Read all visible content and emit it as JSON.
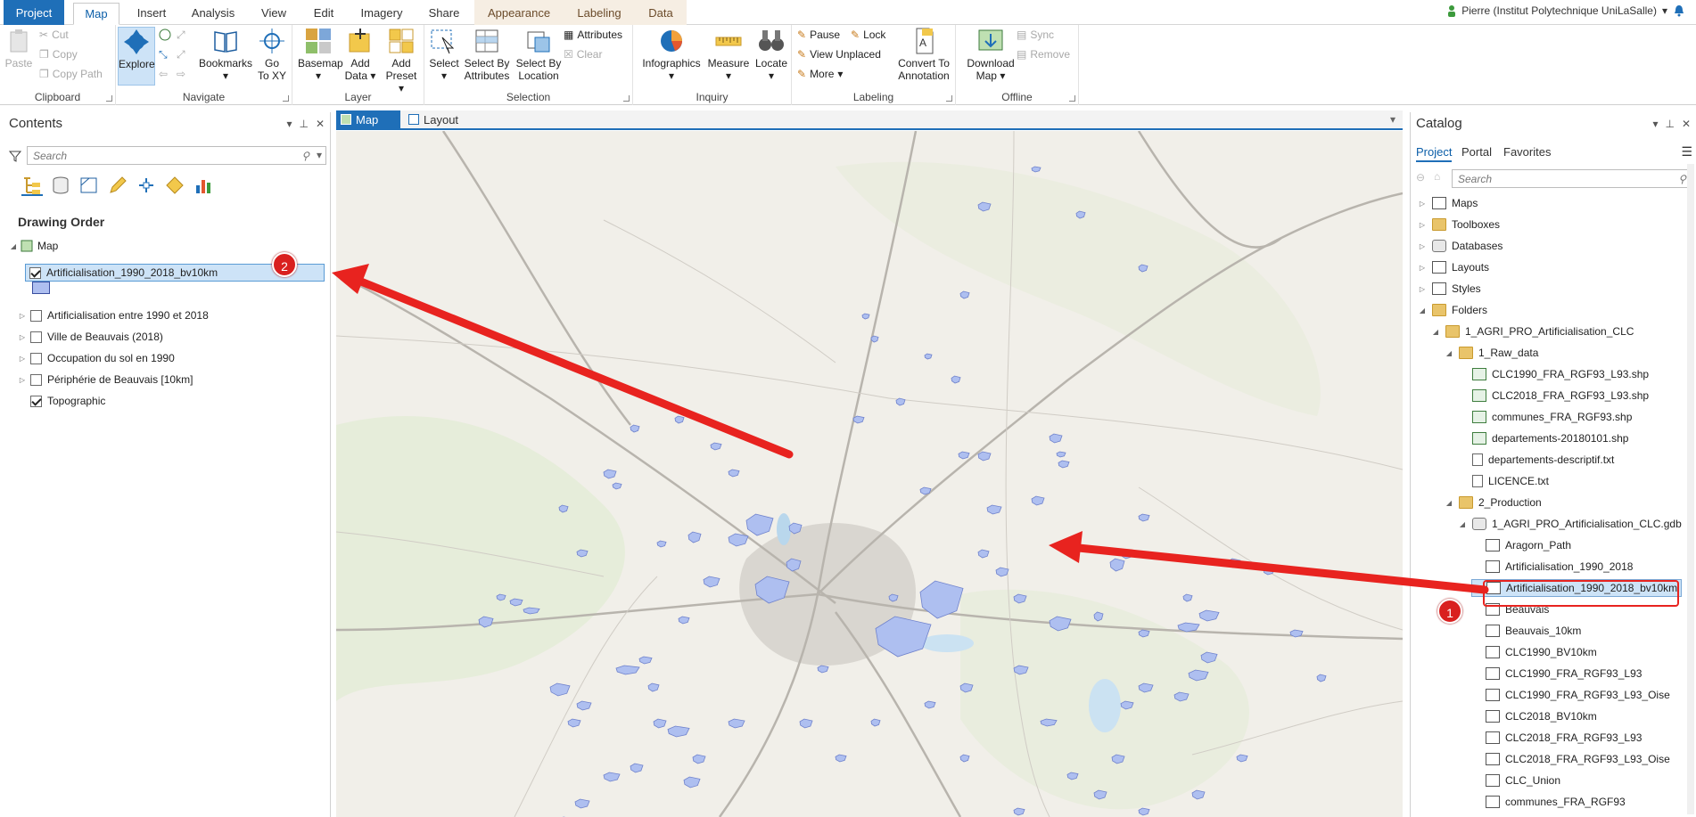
{
  "tabs": {
    "project": "Project",
    "map": "Map",
    "insert": "Insert",
    "analysis": "Analysis",
    "view": "View",
    "edit": "Edit",
    "imagery": "Imagery",
    "share": "Share",
    "appearance": "Appearance",
    "labeling": "Labeling",
    "data": "Data"
  },
  "user": {
    "name": "Pierre (Institut Polytechnique UniLaSalle)"
  },
  "ribbon": {
    "clipboard": {
      "label": "Clipboard",
      "paste": "Paste",
      "cut": "Cut",
      "copy": "Copy",
      "copy_path": "Copy Path"
    },
    "navigate": {
      "label": "Navigate",
      "explore": "Explore",
      "bookmarks": "Bookmarks",
      "go_to_xy_1": "Go",
      "go_to_xy_2": "To XY"
    },
    "layer": {
      "label": "Layer",
      "basemap": "Basemap",
      "add_data_1": "Add",
      "add_data_2": "Data",
      "add_preset_1": "Add",
      "add_preset_2": "Preset"
    },
    "selection": {
      "label": "Selection",
      "select": "Select",
      "select_by_attr_1": "Select By",
      "select_by_attr_2": "Attributes",
      "select_by_loc_1": "Select By",
      "select_by_loc_2": "Location",
      "attributes": "Attributes",
      "clear": "Clear"
    },
    "inquiry": {
      "label": "Inquiry",
      "infographics": "Infographics",
      "measure": "Measure",
      "locate": "Locate"
    },
    "labeling": {
      "label": "Labeling",
      "pause": "Pause",
      "lock": "Lock",
      "view_unplaced": "View Unplaced",
      "more": "More",
      "convert_1": "Convert To",
      "convert_2": "Annotation"
    },
    "offline": {
      "label": "Offline",
      "download_1": "Download",
      "download_2": "Map",
      "sync": "Sync",
      "remove": "Remove"
    }
  },
  "contents": {
    "title": "Contents",
    "search_placeholder": "Search",
    "drawing_order": "Drawing Order",
    "map_node": "Map",
    "layers": [
      {
        "name": "Artificialisation_1990_2018_bv10km",
        "checked": true
      },
      {
        "name": "Artificialisation entre 1990 et 2018",
        "checked": false
      },
      {
        "name": "Ville de Beauvais (2018)",
        "checked": false
      },
      {
        "name": "Occupation du sol en 1990",
        "checked": false
      },
      {
        "name": "Périphérie de Beauvais [10km]",
        "checked": false
      },
      {
        "name": "Topographic",
        "checked": true
      }
    ],
    "symbol_color": "#aebff0"
  },
  "views": {
    "map": "Map",
    "layout": "Layout"
  },
  "catalog": {
    "title": "Catalog",
    "tabs": {
      "project": "Project",
      "portal": "Portal",
      "favorites": "Favorites"
    },
    "search_placeholder": "Search",
    "items": [
      "Maps",
      "Toolboxes",
      "Databases",
      "Layouts",
      "Styles",
      "Folders",
      "1_AGRI_PRO_Artificialisation_CLC",
      "1_Raw_data",
      "CLC1990_FRA_RGF93_L93.shp",
      "CLC2018_FRA_RGF93_L93.shp",
      "communes_FRA_RGF93.shp",
      "departements-20180101.shp",
      "departements-descriptif.txt",
      "LICENCE.txt",
      "2_Production",
      "1_AGRI_PRO_Artificialisation_CLC.gdb",
      "Aragorn_Path",
      "Artificialisation_1990_2018",
      "Artificialisation_1990_2018_bv10km",
      "Beauvais",
      "Beauvais_10km",
      "CLC1990_BV10km",
      "CLC1990_FRA_RGF93_L93",
      "CLC1990_FRA_RGF93_L93_Oise",
      "CLC2018_BV10km",
      "CLC2018_FRA_RGF93_L93",
      "CLC2018_FRA_RGF93_L93_Oise",
      "CLC_Union",
      "communes_FRA_RGF93"
    ]
  },
  "callouts": {
    "one": "1",
    "two": "2"
  },
  "colors": {
    "accent": "#1f6fb8",
    "arrow": "#e8231f",
    "feature": "#aebff0",
    "basemap": "#f1efe9"
  }
}
